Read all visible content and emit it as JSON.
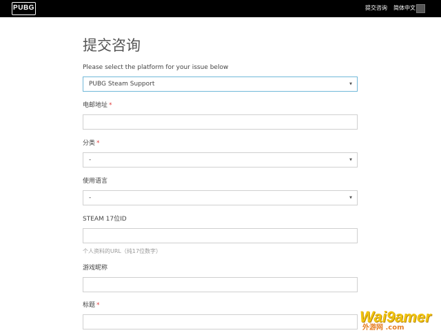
{
  "header": {
    "logo": "PUBG",
    "nav": {
      "consult": "提交咨询",
      "language": "简体中文"
    },
    "colors": {
      "bar": "#000000",
      "text": "#ffffff"
    }
  },
  "form": {
    "title": "提交咨询",
    "platform": {
      "label": "Please select the platform for your issue below",
      "value": "PUBG Steam Support"
    },
    "email": {
      "label": "电邮地址",
      "required_mark": "*",
      "value": ""
    },
    "category": {
      "label": "分类",
      "required_mark": "*",
      "value": "-"
    },
    "language": {
      "label": "使用语言",
      "value": "-"
    },
    "steam_id": {
      "label": "STEAM 17位ID",
      "value": "",
      "hint": "个人资料的URL（纯17位数字）"
    },
    "nickname": {
      "label": "游戏昵称",
      "value": ""
    },
    "subject": {
      "label": "标题",
      "required_mark": "*",
      "value": ""
    },
    "colors": {
      "required": "#e03b3b",
      "focus_border": "#6fb7d9",
      "border": "#cfcfcf"
    }
  },
  "watermark": {
    "word": "Wai9amer",
    "sub": "外游网 .com"
  },
  "icons": {
    "select_caret": "▼"
  }
}
